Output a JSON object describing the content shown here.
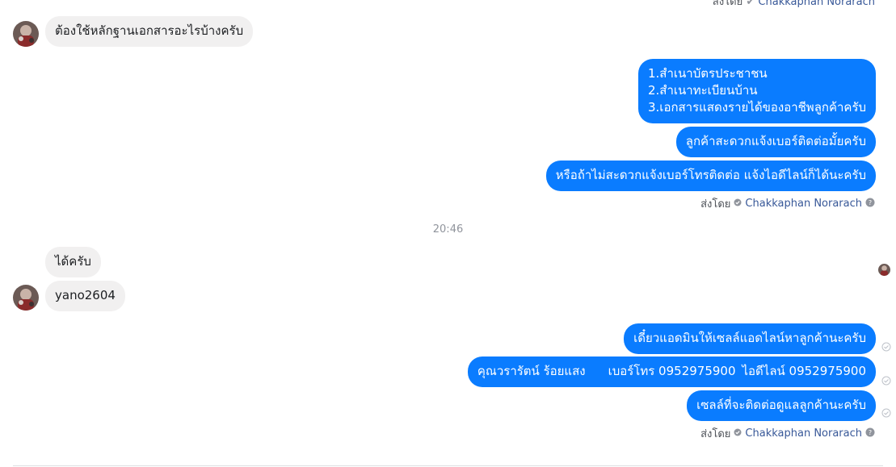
{
  "header_cut": {
    "sent_by": "ส่งโดย",
    "sender": "Chakkaphan Norarach"
  },
  "messages": [
    {
      "dir": "in",
      "text": "ต้องใช้หลักฐานเอกสารอะไรบ้างครับ"
    },
    {
      "dir": "out",
      "lines": [
        "1.สำเนาบัตรประชาชน",
        "2.สำเนาทะเบียนบ้าน",
        "3.เอกสารแสดงรายได้ของอาชีพลูกค้าครับ"
      ]
    },
    {
      "dir": "out",
      "text": "ลูกค้าสะดวกแจ้งเบอร์ติดต่อมั้ยครับ"
    },
    {
      "dir": "out",
      "text": "หรือถ้าไม่สะดวกแจ้งเบอร์โทรติดต่อ แจ้งไอดีไลน์ก็ได้นะครับ"
    },
    {
      "dir": "in",
      "text": "ได้ครับ"
    },
    {
      "dir": "in",
      "text": "yano2604"
    },
    {
      "dir": "out",
      "text": "เดี๋ยวแอดมินให้เซลล์แอดไลน์หาลูกค้านะครับ"
    },
    {
      "dir": "out",
      "parts": [
        "คุณวรารัตน์ ร้อยแสง",
        "เบอร์โทร 0952975900",
        "ไอดีไลน์ 0952975900"
      ]
    },
    {
      "dir": "out",
      "text": "เซลล์ที่จะติดต่อดูแลลูกค้านะครับ"
    }
  ],
  "sent_by_1": {
    "label": "ส่งโดย",
    "sender": "Chakkaphan Norarach"
  },
  "sent_by_2": {
    "label": "ส่งโดย",
    "sender": "Chakkaphan Norarach"
  },
  "timestamp": "20:46",
  "colors": {
    "outgoing": "#0a7cff",
    "incoming": "#f1f0f0",
    "sender_link": "#385898"
  },
  "icons": [
    "avatar",
    "check-circle-icon",
    "help-icon",
    "delivered-status-icon"
  ]
}
